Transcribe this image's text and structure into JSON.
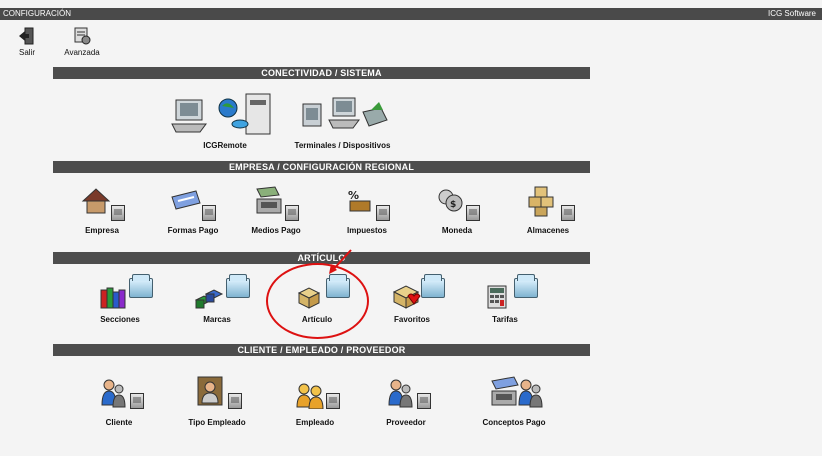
{
  "window": {
    "title": "CONFIGURACIÓN",
    "brand": "ICG Software"
  },
  "toolbar": {
    "exit_label": "Salir",
    "advanced_label": "Avanzada"
  },
  "sections": {
    "connectivity": "CONECTIVIDAD / SISTEMA",
    "company": "EMPRESA / CONFIGURACIÓN REGIONAL",
    "article": "ARTÍCULO",
    "people": "CLIENTE / EMPLEADO / PROVEEDOR"
  },
  "connectivity": {
    "icgremote": "ICGRemote",
    "terminals": "Terminales / Dispositivos"
  },
  "company": {
    "empresa": "Empresa",
    "formas_pago": "Formas Pago",
    "medios_pago": "Medios Pago",
    "impuestos": "Impuestos",
    "moneda": "Moneda",
    "almacenes": "Almacenes"
  },
  "article": {
    "secciones": "Secciones",
    "marcas": "Marcas",
    "articulo": "Artículo",
    "favoritos": "Favoritos",
    "tarifas": "Tarifas"
  },
  "people": {
    "cliente": "Cliente",
    "tipo_empleado": "Tipo Empleado",
    "empleado": "Empleado",
    "proveedor": "Proveedor",
    "conceptos_pago": "Conceptos Pago"
  },
  "colors": {
    "section_bar": "#4d4d4d",
    "annotation": "#dd1111"
  },
  "icons": {
    "exit": "exit-door-icon",
    "advanced": "advanced-settings-icon",
    "icgremote": "remote-computer-icon",
    "terminals": "terminals-icon",
    "empresa": "house-icon",
    "formas_pago": "card-icon",
    "medios_pago": "cash-register-icon",
    "impuestos": "percent-icon",
    "moneda": "coins-icon",
    "almacenes": "boxes-icon",
    "secciones": "books-icon",
    "marcas": "cubes-icon",
    "articulo": "box-icon",
    "favoritos": "heart-box-icon",
    "tarifas": "calculator-icon",
    "cliente": "person-icon",
    "tipo_empleado": "person-group-icon",
    "empleado": "people-icon",
    "proveedor": "supplier-icon",
    "conceptos_pago": "payment-concepts-icon"
  }
}
